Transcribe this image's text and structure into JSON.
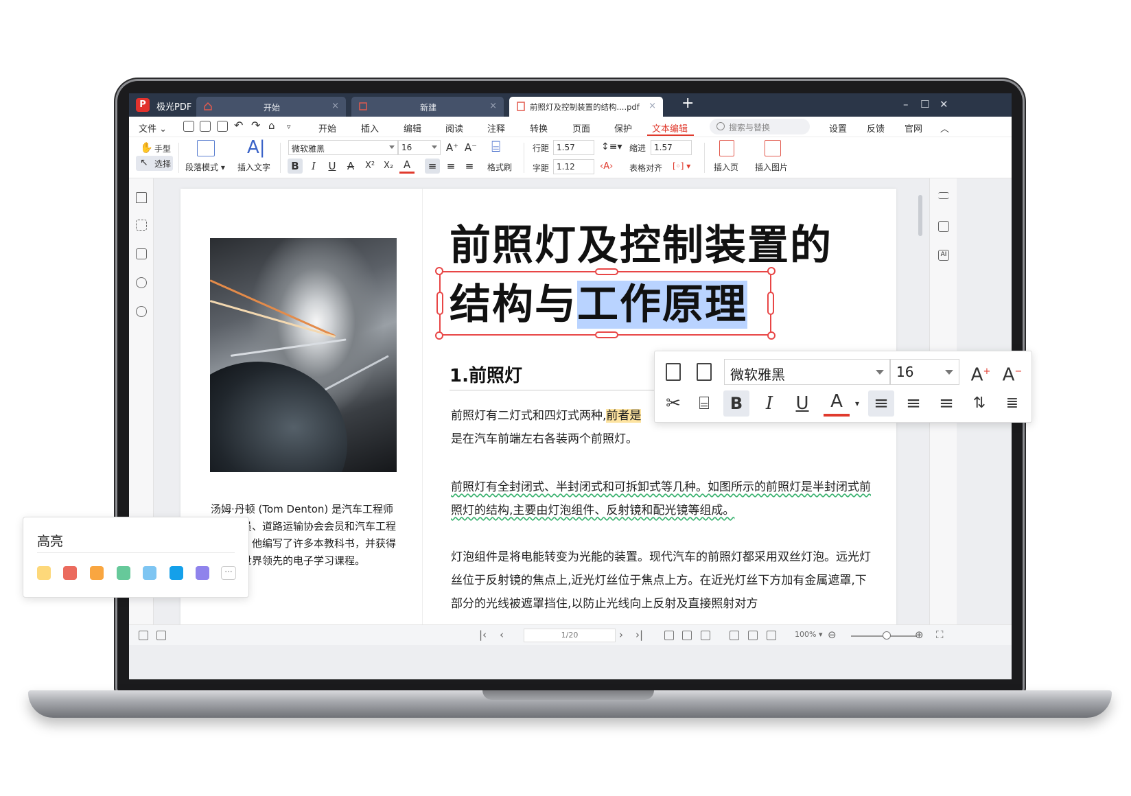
{
  "app": {
    "name": "极光PDF",
    "logo_letter": "P",
    "tabs": [
      {
        "label": "开始"
      },
      {
        "label": "新建"
      },
      {
        "label": "前照灯及控制装置的结构....pdf"
      }
    ],
    "tab_close": "×",
    "new_tab": "+",
    "window_controls": {
      "minimize": "–",
      "maximize": "☐",
      "close": "✕"
    }
  },
  "menubar": {
    "file": "文件",
    "items": [
      "开始",
      "插入",
      "编辑",
      "阅读",
      "注释",
      "转换",
      "页面",
      "保护",
      "文本编辑"
    ],
    "active_index": 8,
    "search_placeholder": "搜索与替换",
    "right_items": [
      "设置",
      "反馈",
      "官网"
    ],
    "collapse": "︿"
  },
  "ribbon": {
    "hand_tool": "手型",
    "select_tool": "选择",
    "paragraph_mode": "段落模式",
    "insert_text": "插入文字",
    "font_name": "微软雅黑",
    "font_size": "16",
    "format_painter": "格式刷",
    "line_spacing_label": "行距",
    "line_spacing_value": "1.57",
    "char_spacing_label": "字距",
    "char_spacing_value": "1.12",
    "indent_label": "缩进",
    "indent_value": "1.57",
    "table_align": "表格对齐",
    "insert_page": "插入页",
    "insert_image": "插入图片",
    "format_buttons": [
      "B",
      "I",
      "U",
      "A",
      "X²",
      "X₂",
      "A"
    ]
  },
  "document": {
    "title_line1": "前照灯及控制装置的",
    "title_line2_plain": "结构与",
    "title_line2_selected": "工作原理",
    "caption": "汤姆·丹顿 (Tom Denton) 是汽车工程师学会会员、道路运输协会会员和汽车工程师协会。他编写了许多本教科书，并获得了支持世界领先的电子学习课程。",
    "section_title": "1.前照灯",
    "para1_a": "前照灯有二灯式和四灯式两种,",
    "para1_highlight": "前者是",
    "para1_b": "是在汽车前端左右各装两个前照灯。",
    "para2": "前照灯有全封闭式、半封闭式和可拆卸式等几种。如图所示的前照灯是半封闭式前照灯的结构,主要由灯泡组件、反射镜和配光镜等组成。",
    "para3": "灯泡组件是将电能转变为光能的装置。现代汽车的前照灯都采用双丝灯泡。远光灯丝位于反射镜的焦点上,近光灯丝位于焦点上方。在近光灯丝下方加有金属遮罩,下部分的光线被遮罩挡住,以防止光线向上反射及直接照射对方"
  },
  "statusbar": {
    "page_indicator": "1/20",
    "zoom": "100%"
  },
  "float_toolbar": {
    "font_name": "微软雅黑",
    "font_size": "16",
    "bold": "B",
    "italic": "I",
    "underline": "U",
    "font_color": "A"
  },
  "highlight_panel": {
    "title": "高亮",
    "colors": [
      "#fdd87a",
      "#eb6b5e",
      "#f9a640",
      "#66c99a",
      "#7ec5f2",
      "#14a0ea",
      "#8f83ec"
    ],
    "more": "···"
  },
  "colors": {
    "accent": "#e03a2d",
    "selection": "#b9d3ff",
    "text_highlight": "#fde3a0",
    "squiggle": "#3cb371"
  }
}
